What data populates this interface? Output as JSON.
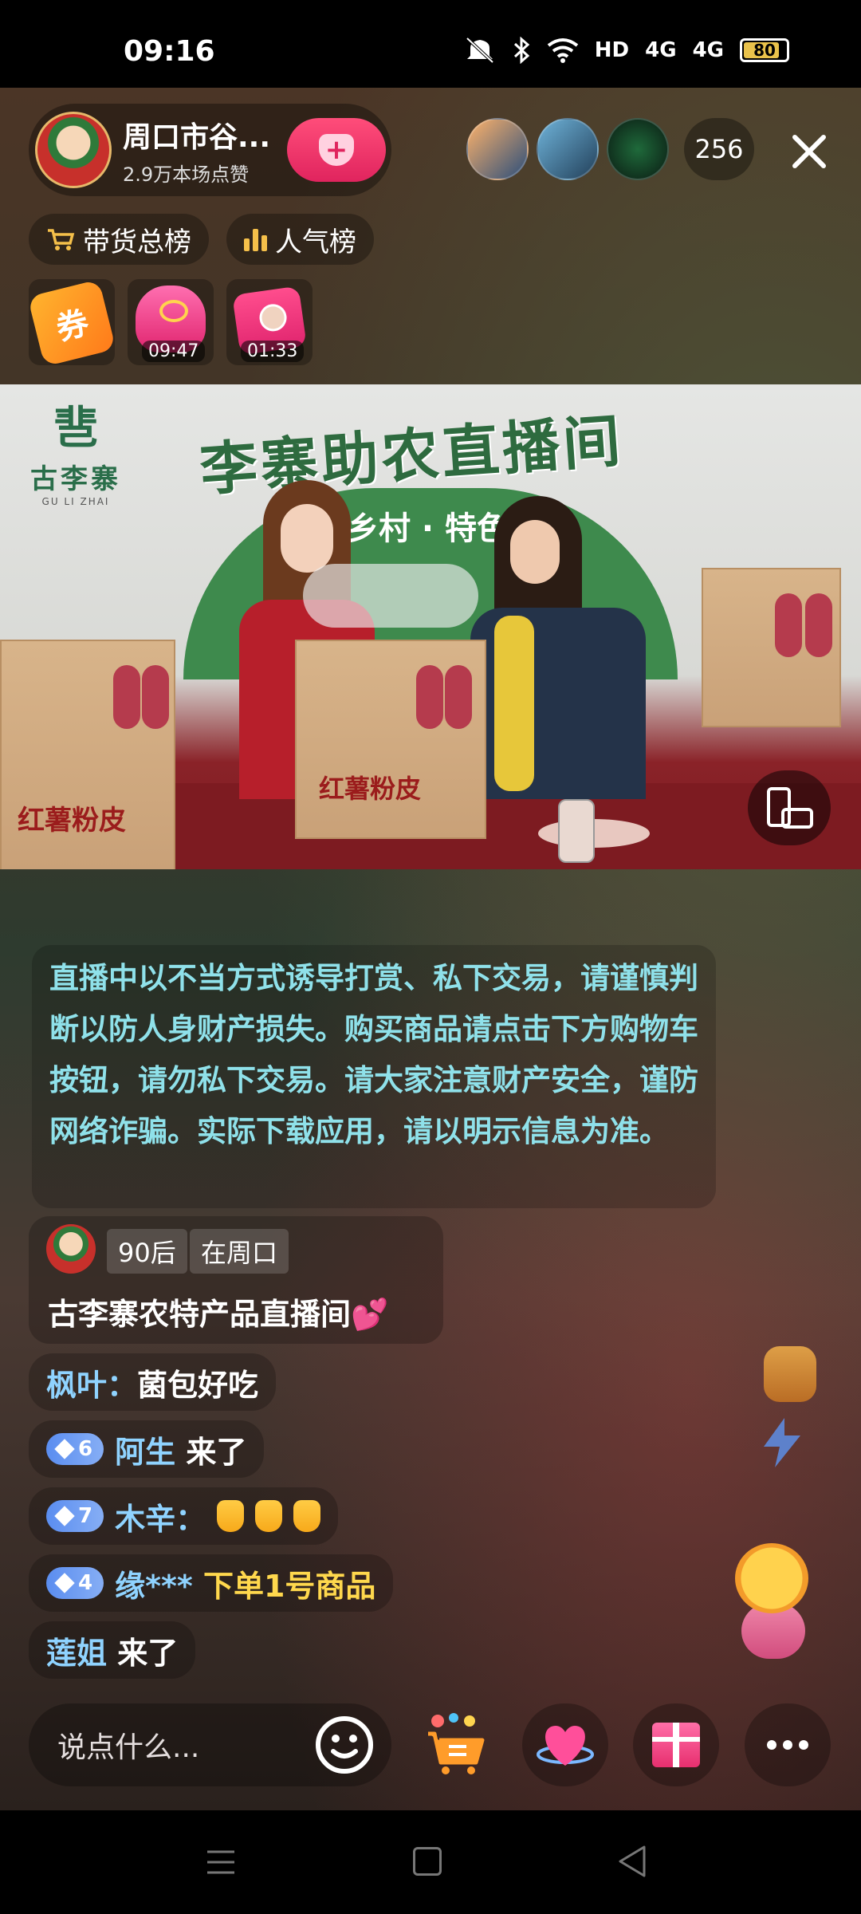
{
  "status_bar": {
    "time": "09:16",
    "network_hd": "HD",
    "network_1": "4G",
    "network_2": "4G",
    "battery": "80"
  },
  "host": {
    "name": "周口市谷...",
    "likes": "2.9万本场点赞",
    "follow_icon": "heart-plus-icon"
  },
  "viewers": {
    "count": "256"
  },
  "ranks": {
    "sales": "带货总榜",
    "popularity": "人气榜"
  },
  "promos": [
    {
      "icon": "coupon-icon",
      "label": "券"
    },
    {
      "icon": "lucky-bag-icon",
      "timer": "09:47"
    },
    {
      "icon": "red-envelope-icon",
      "timer": "01:33"
    }
  ],
  "video": {
    "brand_mark": "䨽",
    "brand_name": "古李寨",
    "brand_sub": "GU LI ZHAI",
    "banner_title": "李寨助农直播间",
    "banner_sub": "美丽乡村 · 特色产",
    "box_label": "红薯粉皮"
  },
  "notice": "直播中以不当方式诱导打赏、私下交易，请谨慎判断以防人身财产损失。购买商品请点击下方购物车按钮，请勿私下交易。请大家注意财产安全，谨防网络诈骗。实际下载应用，请以明示信息为准。",
  "intro": {
    "tag1": "90后",
    "tag2": "在周口",
    "text": "古李寨农特产品直播间💕"
  },
  "chat": [
    {
      "name": "枫叶：",
      "text": "菌包好吃"
    },
    {
      "level": "6",
      "name": "阿生",
      "text": "来了"
    },
    {
      "level": "7",
      "name": "木辛：",
      "text": ""
    },
    {
      "level": "4",
      "name": "缘***",
      "text": "下单1号商品"
    },
    {
      "name": "莲姐",
      "text": "来了"
    }
  ],
  "bottom": {
    "input_placeholder": "说点什么..."
  },
  "colors": {
    "accent_pink": "#e0245e",
    "notice_text": "#8fe1ea",
    "chat_name": "#8fd3ff",
    "highlight": "#ffd84d"
  }
}
